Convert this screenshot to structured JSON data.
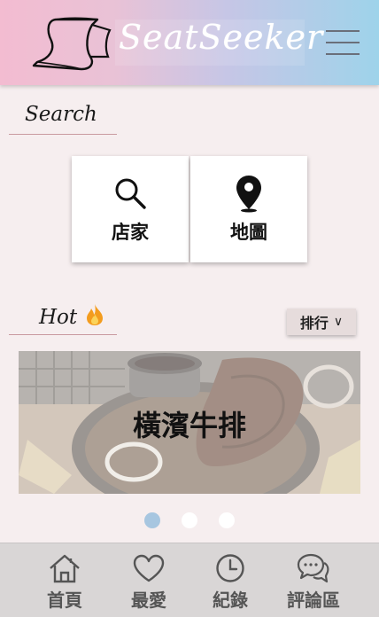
{
  "header": {
    "brand": "SeatSeeker",
    "logo_icon": "curved-seat-logo",
    "menu_icon": "hamburger-menu-icon"
  },
  "search": {
    "title": "Search",
    "tiles": [
      {
        "label": "店家",
        "icon": "search-icon"
      },
      {
        "label": "地圖",
        "icon": "map-pin-icon"
      }
    ]
  },
  "hot": {
    "title": "Hot",
    "title_icon": "fire-icon",
    "sort_label": "排行",
    "sort_chevron": "∨",
    "carousel": {
      "current_title": "橫濱牛排",
      "slide_count": 3,
      "active_index": 0
    }
  },
  "nav": {
    "items": [
      {
        "label": "首頁",
        "icon": "home-icon"
      },
      {
        "label": "最愛",
        "icon": "heart-icon"
      },
      {
        "label": "紀錄",
        "icon": "clock-icon"
      },
      {
        "label": "評論區",
        "icon": "chat-bubbles-icon"
      }
    ]
  },
  "colors": {
    "background": "#f6eeef",
    "header_gradient_start": "#f3bcd1",
    "header_gradient_end": "#9ed3ea",
    "active_dot": "#a7c6e0",
    "nav_background": "#d9d6d6"
  }
}
